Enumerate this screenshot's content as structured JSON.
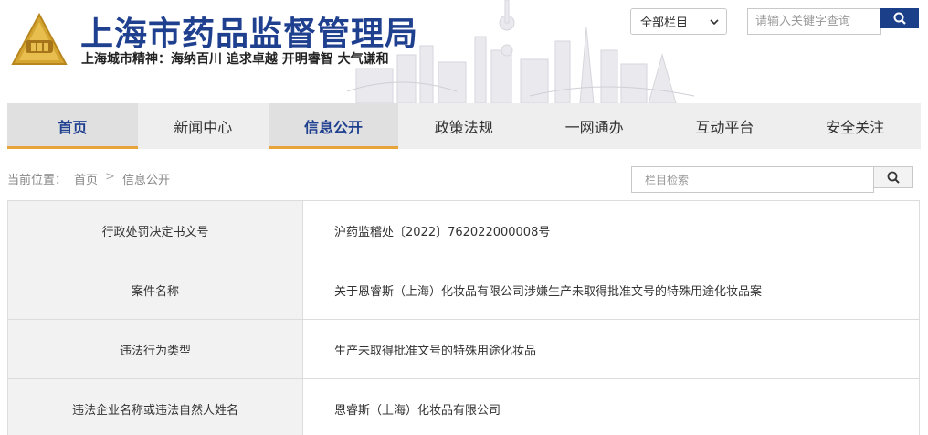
{
  "header": {
    "site_title": "上海市药品监督管理局",
    "slogan": "上海城市精神：海纳百川  追求卓越  开明睿智  大气谦和",
    "scope_select": "全部栏目",
    "search_placeholder": "请输入关键字查询",
    "brand_color": "#1f3f8f",
    "accent_color": "#e8a33a"
  },
  "nav": {
    "items": [
      {
        "label": "首页"
      },
      {
        "label": "新闻中心"
      },
      {
        "label": "信息公开"
      },
      {
        "label": "政策法规"
      },
      {
        "label": "一网通办"
      },
      {
        "label": "互动平台"
      },
      {
        "label": "安全关注"
      }
    ]
  },
  "breadcrumb": {
    "prefix": "当前位置",
    "colon": "：",
    "home": "首页",
    "sep": ">",
    "current": "信息公开"
  },
  "column_search": {
    "placeholder": "栏目检索"
  },
  "table": {
    "rows": [
      {
        "label": "行政处罚决定书文号",
        "value": "沪药监稽处〔2022〕762022000008号"
      },
      {
        "label": "案件名称",
        "value": "关于恩睿斯（上海）化妆品有限公司涉嫌生产未取得批准文号的特殊用途化妆品案"
      },
      {
        "label": "违法行为类型",
        "value": "生产未取得批准文号的特殊用途化妆品"
      },
      {
        "label": "违法企业名称或违法自然人姓名",
        "value": "恩睿斯（上海）化妆品有限公司"
      }
    ]
  }
}
